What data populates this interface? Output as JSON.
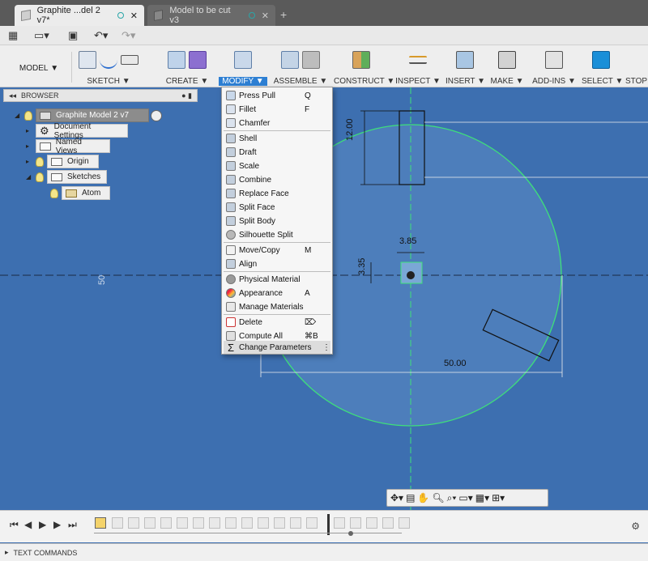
{
  "tabs": [
    {
      "label": "Graphite ...del 2 v7*",
      "active": true
    },
    {
      "label": "Model to be cut v3",
      "active": false
    }
  ],
  "ribbon": {
    "workspace": "MODEL",
    "groups": [
      {
        "label": "SKETCH"
      },
      {
        "label": "CREATE"
      },
      {
        "label": "MODIFY"
      },
      {
        "label": "ASSEMBLE"
      },
      {
        "label": "CONSTRUCT"
      },
      {
        "label": "INSPECT"
      },
      {
        "label": "INSERT"
      },
      {
        "label": "MAKE"
      },
      {
        "label": "ADD-INS"
      },
      {
        "label": "SELECT"
      },
      {
        "label": "STOP"
      }
    ]
  },
  "browser": {
    "title": "BROWSER",
    "root": "Graphite Model 2 v7",
    "items": [
      {
        "label": "Document Settings",
        "icon": "gear-icon"
      },
      {
        "label": "Named Views",
        "icon": "folder-icon"
      },
      {
        "label": "Origin",
        "icon": "folder-icon"
      },
      {
        "label": "Sketches",
        "icon": "folder-icon"
      },
      {
        "label": "Atom",
        "icon": "sketch-icon"
      }
    ]
  },
  "modify_menu": {
    "items": [
      {
        "label": "Press Pull",
        "shortcut": "Q",
        "icon": "press-pull-icon"
      },
      {
        "label": "Fillet",
        "shortcut": "F",
        "icon": "fillet-icon"
      },
      {
        "label": "Chamfer",
        "shortcut": "",
        "icon": "chamfer-icon"
      },
      {
        "label": "Shell",
        "shortcut": "",
        "icon": "shell-icon"
      },
      {
        "label": "Draft",
        "shortcut": "",
        "icon": "draft-icon"
      },
      {
        "label": "Scale",
        "shortcut": "",
        "icon": "scale-icon"
      },
      {
        "label": "Combine",
        "shortcut": "",
        "icon": "combine-icon"
      },
      {
        "label": "Replace Face",
        "shortcut": "",
        "icon": "replace-face-icon"
      },
      {
        "label": "Split Face",
        "shortcut": "",
        "icon": "split-face-icon"
      },
      {
        "label": "Split Body",
        "shortcut": "",
        "icon": "split-body-icon"
      },
      {
        "label": "Silhouette Split",
        "shortcut": "",
        "icon": "silhouette-split-icon"
      },
      {
        "label": "Move/Copy",
        "shortcut": "M",
        "icon": "move-icon"
      },
      {
        "label": "Align",
        "shortcut": "",
        "icon": "align-icon"
      },
      {
        "label": "Physical Material",
        "shortcut": "",
        "icon": "physical-material-icon"
      },
      {
        "label": "Appearance",
        "shortcut": "A",
        "icon": "appearance-icon"
      },
      {
        "label": "Manage Materials",
        "shortcut": "",
        "icon": "manage-materials-icon"
      },
      {
        "label": "Delete",
        "shortcut": "⌦",
        "icon": "delete-icon"
      },
      {
        "label": "Compute All",
        "shortcut": "⌘B",
        "icon": "compute-all-icon"
      },
      {
        "label": "Change Parameters",
        "shortcut": "⋮",
        "icon": "sigma-icon"
      }
    ]
  },
  "canvas": {
    "dimensions": {
      "d1": "12.00",
      "d2": "3.85",
      "d3": "3.35",
      "d4": "50",
      "d5": "50.00"
    }
  },
  "text_commands": "TEXT COMMANDS",
  "colors": {
    "canvas_bg": "#3d6fb0",
    "accent": "#2d7fd3",
    "circle": "#3ee07a"
  }
}
